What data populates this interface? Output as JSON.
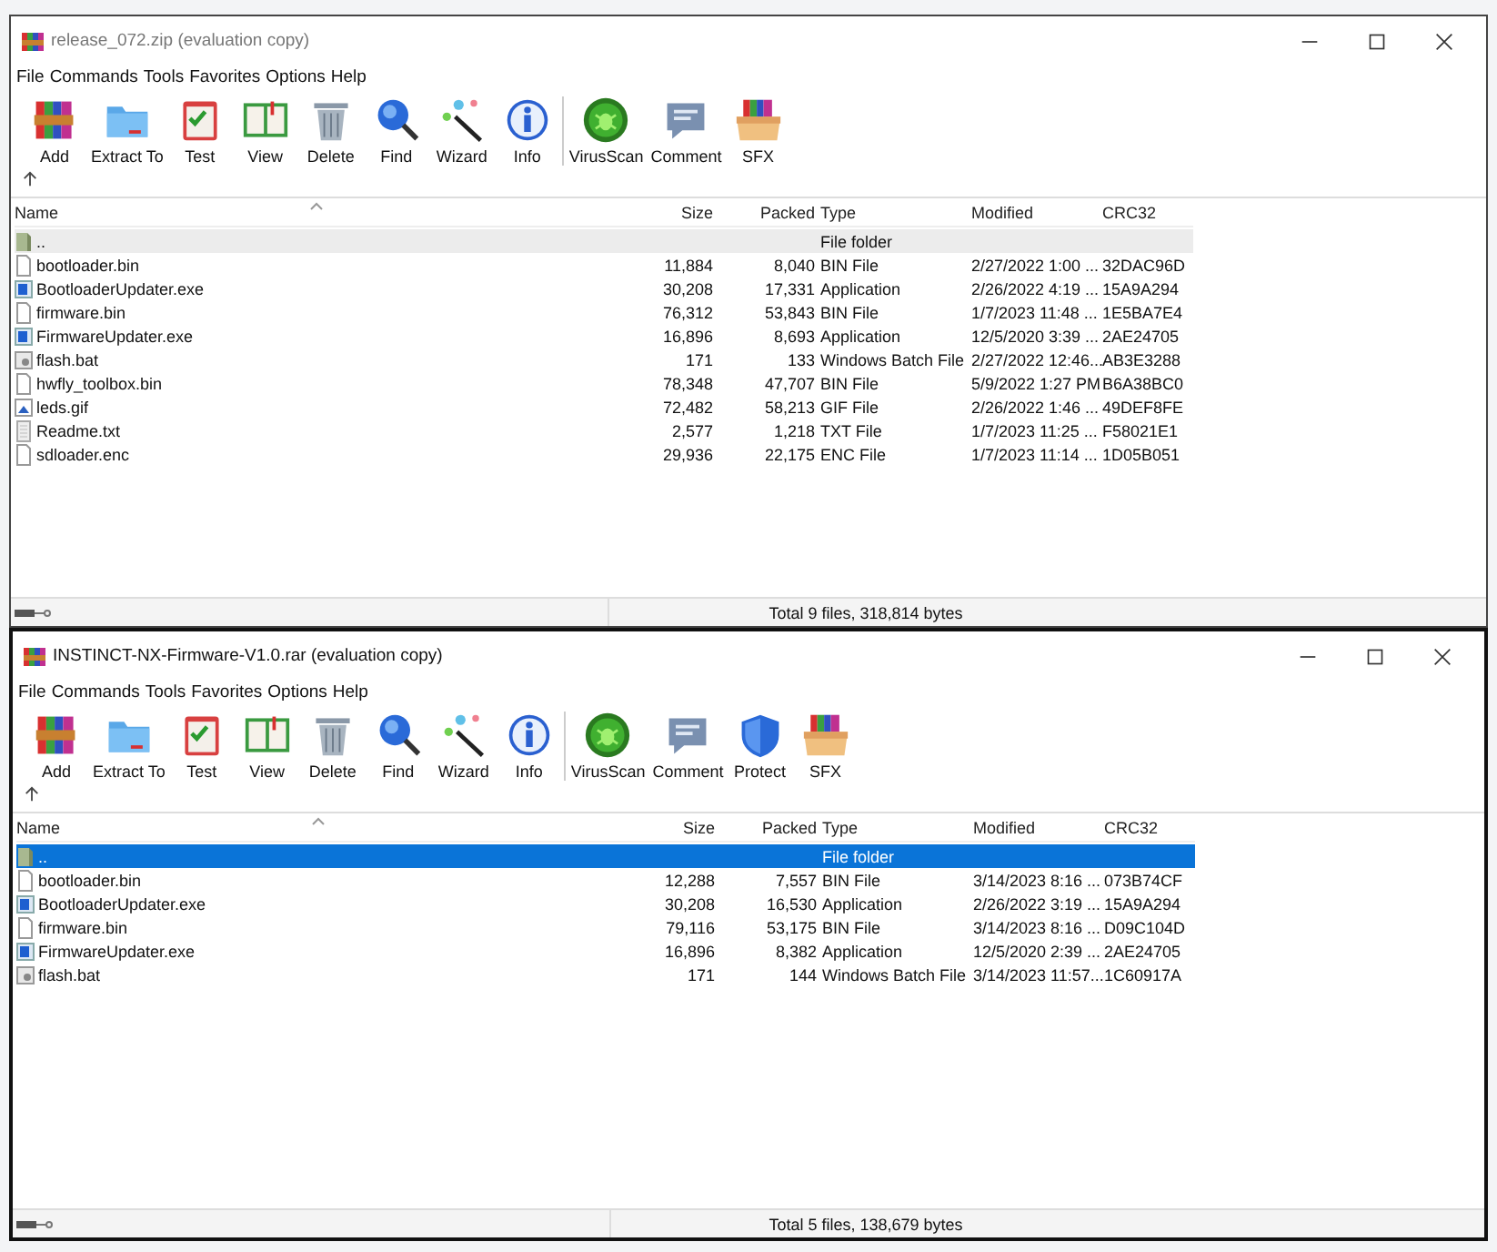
{
  "windows": [
    {
      "title": "release_072.zip (evaluation copy)",
      "menu": [
        "File",
        "Commands",
        "Tools",
        "Favorites",
        "Options",
        "Help"
      ],
      "toolbar": [
        {
          "label": "Add",
          "kind": "add"
        },
        {
          "label": "Extract To",
          "kind": "extract"
        },
        {
          "label": "Test",
          "kind": "test"
        },
        {
          "label": "View",
          "kind": "view"
        },
        {
          "label": "Delete",
          "kind": "delete"
        },
        {
          "label": "Find",
          "kind": "find"
        },
        {
          "label": "Wizard",
          "kind": "wizard"
        },
        {
          "label": "Info",
          "kind": "info"
        },
        {
          "label": "VirusScan",
          "kind": "virus"
        },
        {
          "label": "Comment",
          "kind": "comment"
        },
        {
          "label": "SFX",
          "kind": "sfx"
        }
      ],
      "columns": [
        "Name",
        "Size",
        "Packed",
        "Type",
        "Modified",
        "CRC32"
      ],
      "rows": [
        {
          "kind": "up",
          "name": "..",
          "size": "",
          "packed": "",
          "type": "File folder",
          "modified": "",
          "crc": "",
          "selected": false,
          "highlighted": true
        },
        {
          "kind": "file",
          "name": "bootloader.bin",
          "size": "11,884",
          "packed": "8,040",
          "type": "BIN File",
          "modified": "2/27/2022 1:00 ...",
          "crc": "32DAC96D",
          "selected": false,
          "highlighted": false
        },
        {
          "kind": "exe",
          "name": "BootloaderUpdater.exe",
          "size": "30,208",
          "packed": "17,331",
          "type": "Application",
          "modified": "2/26/2022 4:19 ...",
          "crc": "15A9A294",
          "selected": false,
          "highlighted": false
        },
        {
          "kind": "file",
          "name": "firmware.bin",
          "size": "76,312",
          "packed": "53,843",
          "type": "BIN File",
          "modified": "1/7/2023 11:48 ...",
          "crc": "1E5BA7E4",
          "selected": false,
          "highlighted": false
        },
        {
          "kind": "exe",
          "name": "FirmwareUpdater.exe",
          "size": "16,896",
          "packed": "8,693",
          "type": "Application",
          "modified": "12/5/2020 3:39 ...",
          "crc": "2AE24705",
          "selected": false,
          "highlighted": false
        },
        {
          "kind": "bat",
          "name": "flash.bat",
          "size": "171",
          "packed": "133",
          "type": "Windows Batch File",
          "modified": "2/27/2022 12:46...",
          "crc": "AB3E3288",
          "selected": false,
          "highlighted": false
        },
        {
          "kind": "file",
          "name": "hwfly_toolbox.bin",
          "size": "78,348",
          "packed": "47,707",
          "type": "BIN File",
          "modified": "5/9/2022 1:27 PM",
          "crc": "B6A38BC0",
          "selected": false,
          "highlighted": false
        },
        {
          "kind": "image",
          "name": "leds.gif",
          "size": "72,482",
          "packed": "58,213",
          "type": "GIF File",
          "modified": "2/26/2022 1:46 ...",
          "crc": "49DEF8FE",
          "selected": false,
          "highlighted": false
        },
        {
          "kind": "text",
          "name": "Readme.txt",
          "size": "2,577",
          "packed": "1,218",
          "type": "TXT File",
          "modified": "1/7/2023 11:25 ...",
          "crc": "F58021E1",
          "selected": false,
          "highlighted": false
        },
        {
          "kind": "file",
          "name": "sdloader.enc",
          "size": "29,936",
          "packed": "22,175",
          "type": "ENC File",
          "modified": "1/7/2023 11:14 ...",
          "crc": "1D05B051",
          "selected": false,
          "highlighted": false
        }
      ],
      "status": "Total 9 files, 318,814 bytes"
    },
    {
      "title": "INSTINCT-NX-Firmware-V1.0.rar (evaluation copy)",
      "menu": [
        "File",
        "Commands",
        "Tools",
        "Favorites",
        "Options",
        "Help"
      ],
      "toolbar": [
        {
          "label": "Add",
          "kind": "add"
        },
        {
          "label": "Extract To",
          "kind": "extract"
        },
        {
          "label": "Test",
          "kind": "test"
        },
        {
          "label": "View",
          "kind": "view"
        },
        {
          "label": "Delete",
          "kind": "delete"
        },
        {
          "label": "Find",
          "kind": "find"
        },
        {
          "label": "Wizard",
          "kind": "wizard"
        },
        {
          "label": "Info",
          "kind": "info"
        },
        {
          "label": "VirusScan",
          "kind": "virus"
        },
        {
          "label": "Comment",
          "kind": "comment"
        },
        {
          "label": "Protect",
          "kind": "protect"
        },
        {
          "label": "SFX",
          "kind": "sfx"
        }
      ],
      "columns": [
        "Name",
        "Size",
        "Packed",
        "Type",
        "Modified",
        "CRC32"
      ],
      "rows": [
        {
          "kind": "up",
          "name": "..",
          "size": "",
          "packed": "",
          "type": "File folder",
          "modified": "",
          "crc": "",
          "selected": true,
          "highlighted": false
        },
        {
          "kind": "file",
          "name": "bootloader.bin",
          "size": "12,288",
          "packed": "7,557",
          "type": "BIN File",
          "modified": "3/14/2023 8:16 ...",
          "crc": "073B74CF",
          "selected": false,
          "highlighted": false
        },
        {
          "kind": "exe",
          "name": "BootloaderUpdater.exe",
          "size": "30,208",
          "packed": "16,530",
          "type": "Application",
          "modified": "2/26/2022 3:19 ...",
          "crc": "15A9A294",
          "selected": false,
          "highlighted": false
        },
        {
          "kind": "file",
          "name": "firmware.bin",
          "size": "79,116",
          "packed": "53,175",
          "type": "BIN File",
          "modified": "3/14/2023 8:16 ...",
          "crc": "D09C104D",
          "selected": false,
          "highlighted": false
        },
        {
          "kind": "exe",
          "name": "FirmwareUpdater.exe",
          "size": "16,896",
          "packed": "8,382",
          "type": "Application",
          "modified": "12/5/2020 2:39 ...",
          "crc": "2AE24705",
          "selected": false,
          "highlighted": false
        },
        {
          "kind": "bat",
          "name": "flash.bat",
          "size": "171",
          "packed": "144",
          "type": "Windows Batch File",
          "modified": "3/14/2023 11:57...",
          "crc": "1C60917A",
          "selected": false,
          "highlighted": false
        }
      ],
      "status": "Total 5 files, 138,679 bytes"
    }
  ]
}
